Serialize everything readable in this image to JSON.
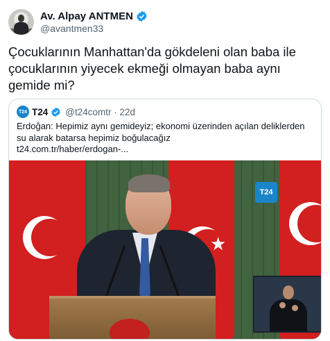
{
  "tweet": {
    "author": {
      "display_name": "Av. Alpay ANTMEN",
      "handle": "@avantmen33",
      "verified": true
    },
    "text": "Çocuklarının Manhattan'da gökdeleni olan baba ile çocuklarının yiyecek ekmeği olmayan baba aynı gemide mi?"
  },
  "quote": {
    "logo_text": "T24",
    "display_name": "T24",
    "handle_time": "@t24comtr · 22d",
    "text": "Erdoğan: Hepimiz aynı gemideyiz; ekonomi üzerinden açılan deliklerden su alarak batarsa hepimiz boğulacağız",
    "link": "t24.com.tr/haber/erdogan-...",
    "media_badge": "T24"
  },
  "colors": {
    "verified": "#1d9bf0",
    "muted": "#536471",
    "flag_red": "#d21f1f",
    "t24_blue": "#1a85c8"
  }
}
